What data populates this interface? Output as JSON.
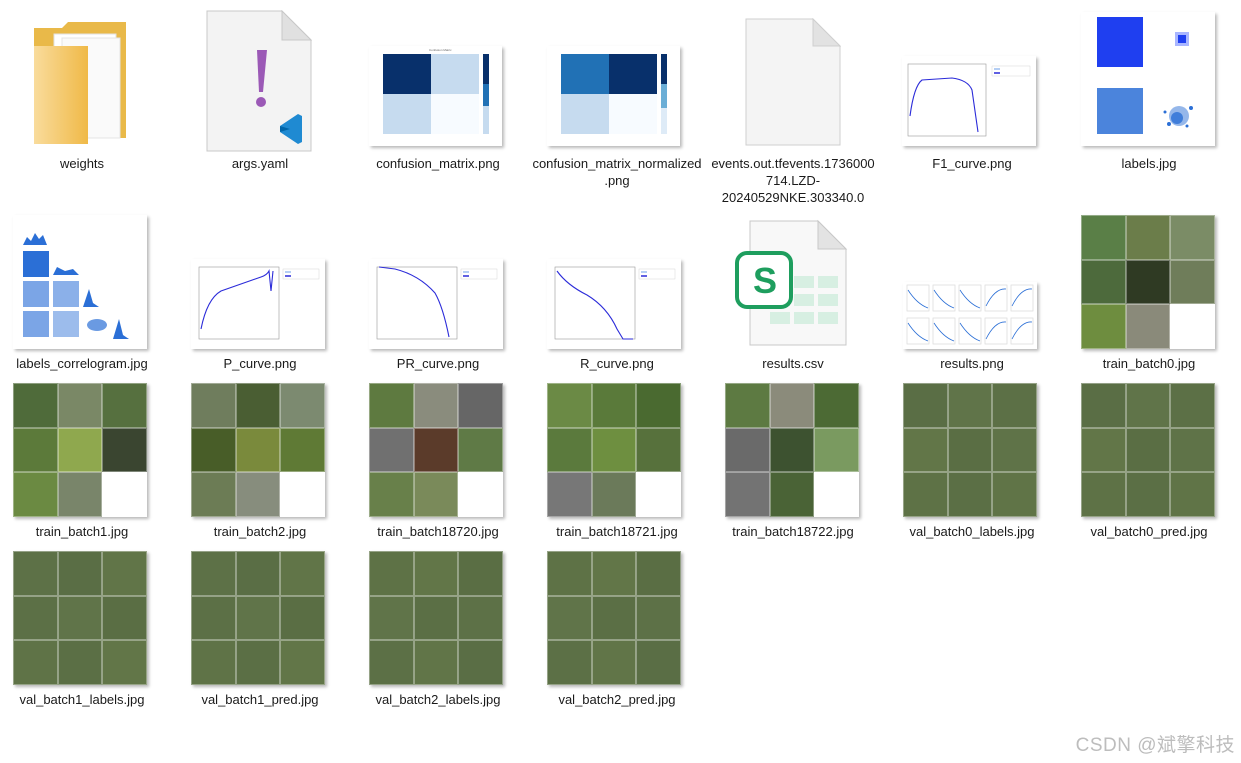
{
  "files": [
    {
      "name": "weights",
      "type": "folder",
      "icon": "folder-icon"
    },
    {
      "name": "args.yaml",
      "type": "yaml",
      "icon": "vscode-yaml-icon"
    },
    {
      "name": "confusion_matrix.png",
      "type": "image",
      "icon": "image-thumbnail"
    },
    {
      "name": "confusion_matrix_normalized.png",
      "type": "image",
      "icon": "image-thumbnail"
    },
    {
      "name": "events.out.tfevents.1736000714.LZD-20240529NKE.303340.0",
      "type": "file",
      "icon": "blank-file-icon"
    },
    {
      "name": "F1_curve.png",
      "type": "image",
      "icon": "image-thumbnail"
    },
    {
      "name": "labels.jpg",
      "type": "image",
      "icon": "image-thumbnail"
    },
    {
      "name": "labels_correlogram.jpg",
      "type": "image",
      "icon": "image-thumbnail"
    },
    {
      "name": "P_curve.png",
      "type": "image",
      "icon": "image-thumbnail"
    },
    {
      "name": "PR_curve.png",
      "type": "image",
      "icon": "image-thumbnail"
    },
    {
      "name": "R_curve.png",
      "type": "image",
      "icon": "image-thumbnail"
    },
    {
      "name": "results.csv",
      "type": "spreadsheet",
      "icon": "wps-spreadsheet-icon"
    },
    {
      "name": "results.png",
      "type": "image",
      "icon": "image-thumbnail"
    },
    {
      "name": "train_batch0.jpg",
      "type": "image",
      "icon": "image-thumbnail"
    },
    {
      "name": "train_batch1.jpg",
      "type": "image",
      "icon": "image-thumbnail"
    },
    {
      "name": "train_batch2.jpg",
      "type": "image",
      "icon": "image-thumbnail"
    },
    {
      "name": "train_batch18720.jpg",
      "type": "image",
      "icon": "image-thumbnail"
    },
    {
      "name": "train_batch18721.jpg",
      "type": "image",
      "icon": "image-thumbnail"
    },
    {
      "name": "train_batch18722.jpg",
      "type": "image",
      "icon": "image-thumbnail"
    },
    {
      "name": "val_batch0_labels.jpg",
      "type": "image",
      "icon": "image-thumbnail"
    },
    {
      "name": "val_batch0_pred.jpg",
      "type": "image",
      "icon": "image-thumbnail"
    },
    {
      "name": "val_batch1_labels.jpg",
      "type": "image",
      "icon": "image-thumbnail"
    },
    {
      "name": "val_batch1_pred.jpg",
      "type": "image",
      "icon": "image-thumbnail"
    },
    {
      "name": "val_batch2_labels.jpg",
      "type": "image",
      "icon": "image-thumbnail"
    },
    {
      "name": "val_batch2_pred.jpg",
      "type": "image",
      "icon": "image-thumbnail"
    }
  ],
  "thumbnail_text": {
    "csv_letter": "S"
  },
  "colors": {
    "folder": "#f5c45a",
    "yaml_mark": "#9b59b6",
    "vscode_blue": "#1f8ad2",
    "csv_green": "#1e9e5e",
    "curve_blue": "#2b2bd9",
    "matrix_dark": "#08306b",
    "matrix_light": "#c6dbef"
  },
  "watermark": "CSDN @斌擎科技"
}
